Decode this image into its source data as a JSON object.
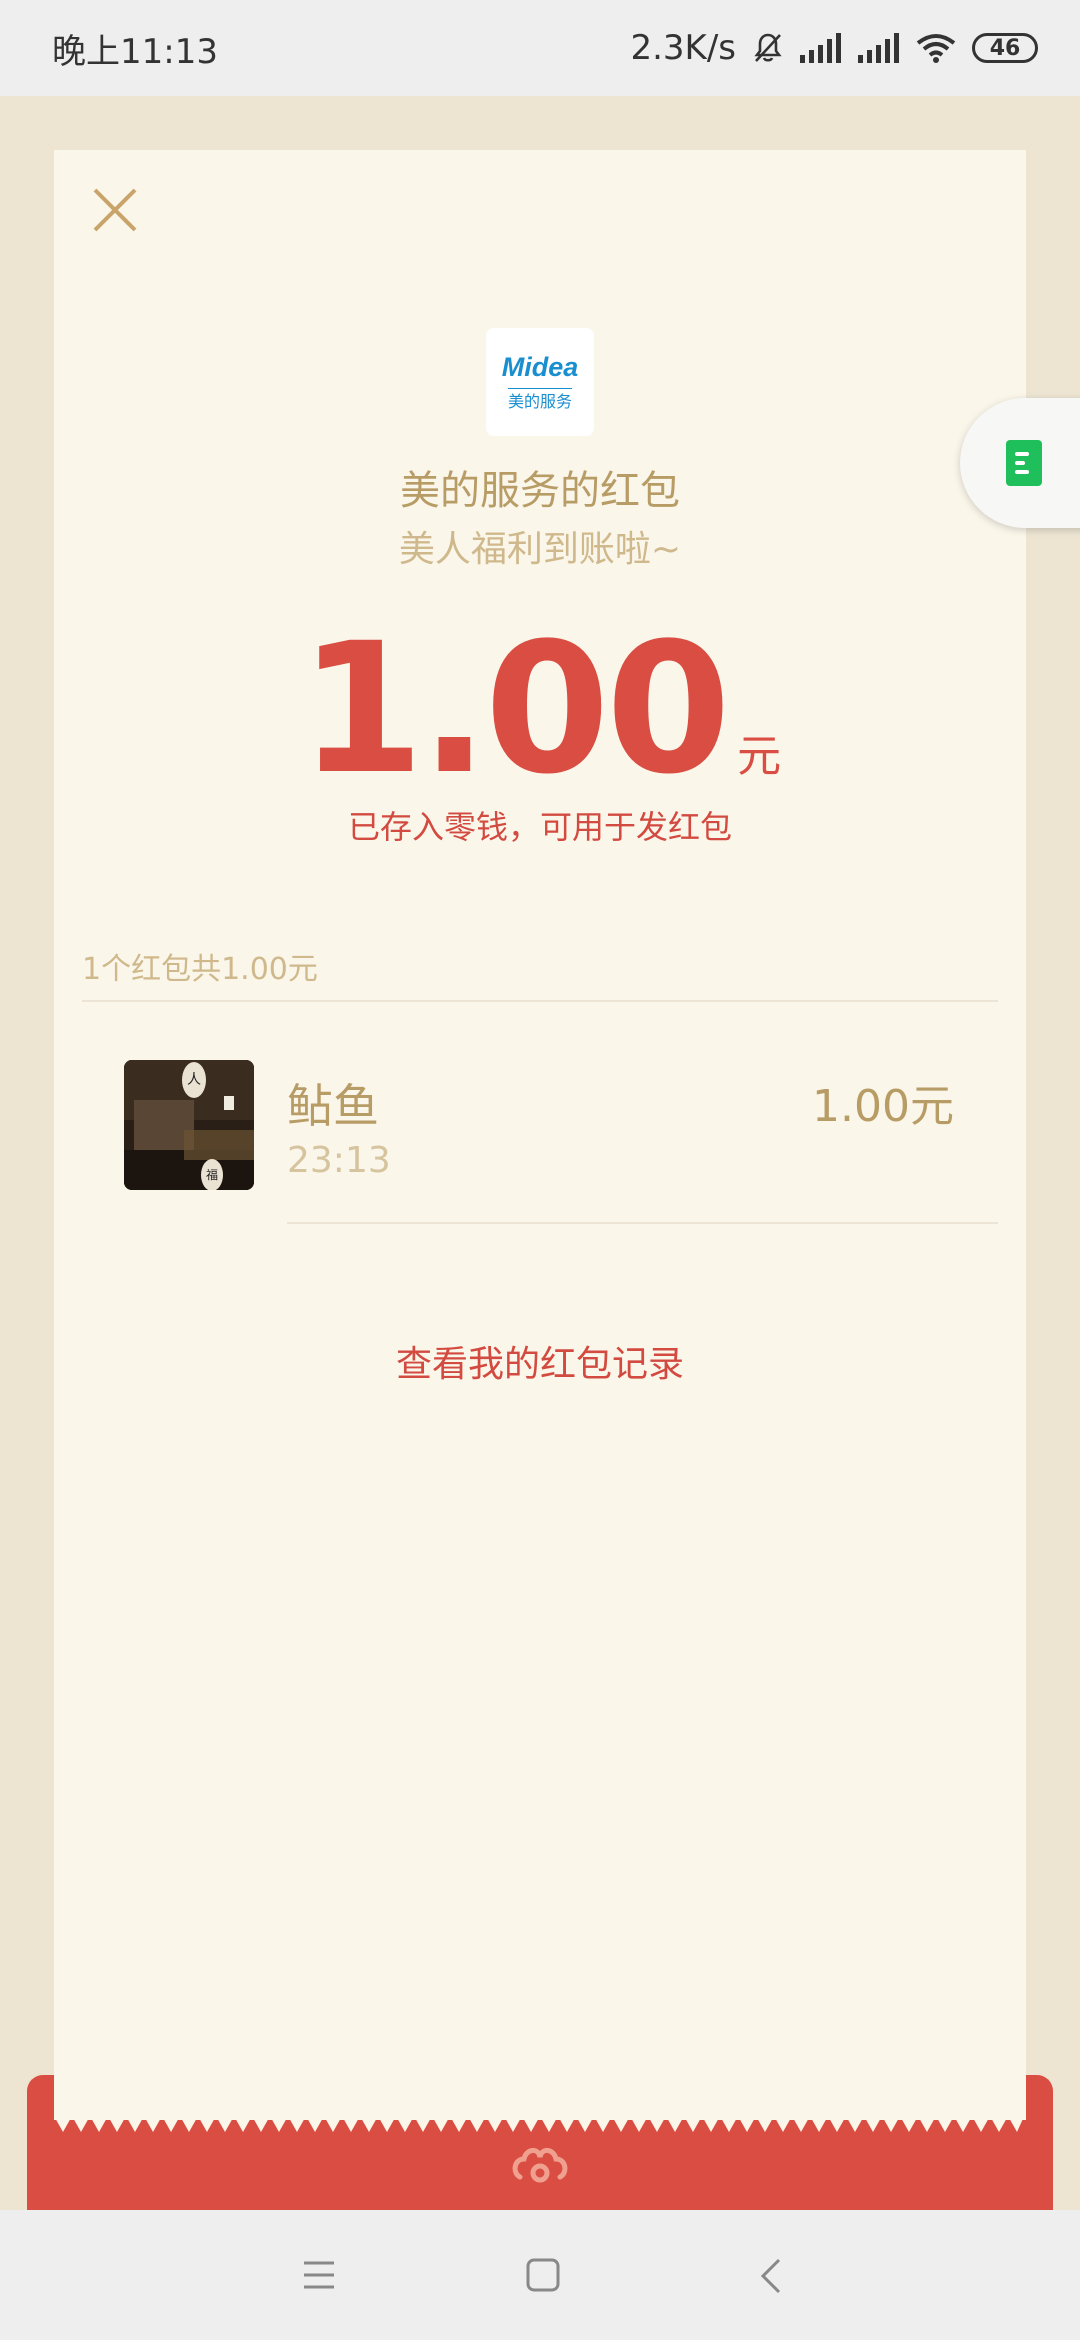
{
  "status_bar": {
    "time": "晚上11:13",
    "network_speed": "2.3K/s",
    "battery": "46"
  },
  "redpacket": {
    "sender_logo": {
      "brand": "Midea",
      "sub": "美的服务"
    },
    "sender_title": "美的服务的红包",
    "greeting": "美人福利到账啦~",
    "amount": "1.00",
    "unit": "元",
    "amount_note": "已存入零钱，可用于发红包",
    "summary": "1个红包共1.00元",
    "receivers": [
      {
        "name": "鲇鱼",
        "time": "23:13",
        "amount": "1.00元"
      }
    ],
    "record_link": "查看我的红包记录"
  },
  "colors": {
    "accent_red": "#d94d43",
    "gold": "#b89c66",
    "card_bg": "#fbf6ea"
  }
}
